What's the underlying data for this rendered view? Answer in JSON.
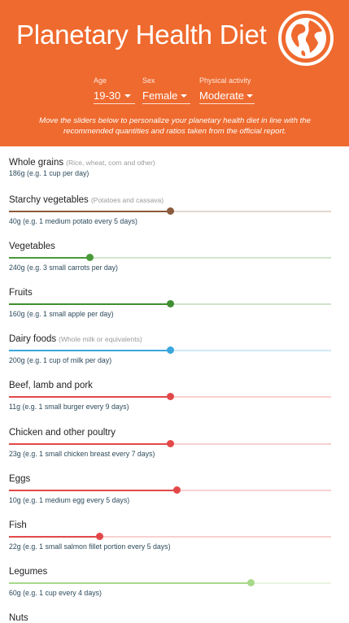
{
  "header": {
    "title": "Planetary Health Diet",
    "intro": "Move the sliders below to personalize your planetary health diet in line with the recommended quantities and ratios taken from the official report.",
    "bg_color": "#ef6a2e"
  },
  "selects": {
    "age": {
      "label": "Age",
      "value": "19-30"
    },
    "sex": {
      "label": "Sex",
      "value": "Female"
    },
    "activity": {
      "label": "Physical activity",
      "value": "Moderate"
    }
  },
  "foods": [
    {
      "name": "Whole grains",
      "note": "(Rice, wheat, corn and other)",
      "amount": "186g (e.g. 1 cup per day)",
      "level": null,
      "color": "#999999"
    },
    {
      "name": "Starchy vegetables",
      "note": "(Potatoes and cassava)",
      "amount": "40g (e.g. 1 medium potato every 5 days)",
      "level": 0.5,
      "color": "#8b5a3c"
    },
    {
      "name": "Vegetables",
      "note": "",
      "amount": "240g (e.g. 3 small carrots per day)",
      "level": 0.25,
      "color": "#4a9a3a"
    },
    {
      "name": "Fruits",
      "note": "",
      "amount": "160g (e.g. 1 small apple per day)",
      "level": 0.5,
      "color": "#3f8f2f"
    },
    {
      "name": "Dairy foods",
      "note": "(Whole milk or equivalents)",
      "amount": "200g (e.g. 1 cup of milk per day)",
      "level": 0.5,
      "color": "#3aa6dd"
    },
    {
      "name": "Beef, lamb and pork",
      "note": "",
      "amount": "11g (e.g. 1 small burger every 9 days)",
      "level": 0.5,
      "color": "#e34848"
    },
    {
      "name": "Chicken and other poultry",
      "note": "",
      "amount": "23g (e.g. 1 small chicken breast every 7 days)",
      "level": 0.5,
      "color": "#e34848"
    },
    {
      "name": "Eggs",
      "note": "",
      "amount": "10g (e.g. 1 medium egg every 5 days)",
      "level": 0.52,
      "color": "#e34848"
    },
    {
      "name": "Fish",
      "note": "",
      "amount": "22g (e.g. 1 small salmon fillet portion every 5 days)",
      "level": 0.28,
      "color": "#e34848"
    },
    {
      "name": "Legumes",
      "note": "",
      "amount": "60g (e.g. 1 cup every 4 days)",
      "level": 0.75,
      "color": "#a8d88a"
    },
    {
      "name": "Nuts",
      "note": "",
      "amount": "",
      "level": null,
      "color": "#999999"
    }
  ]
}
